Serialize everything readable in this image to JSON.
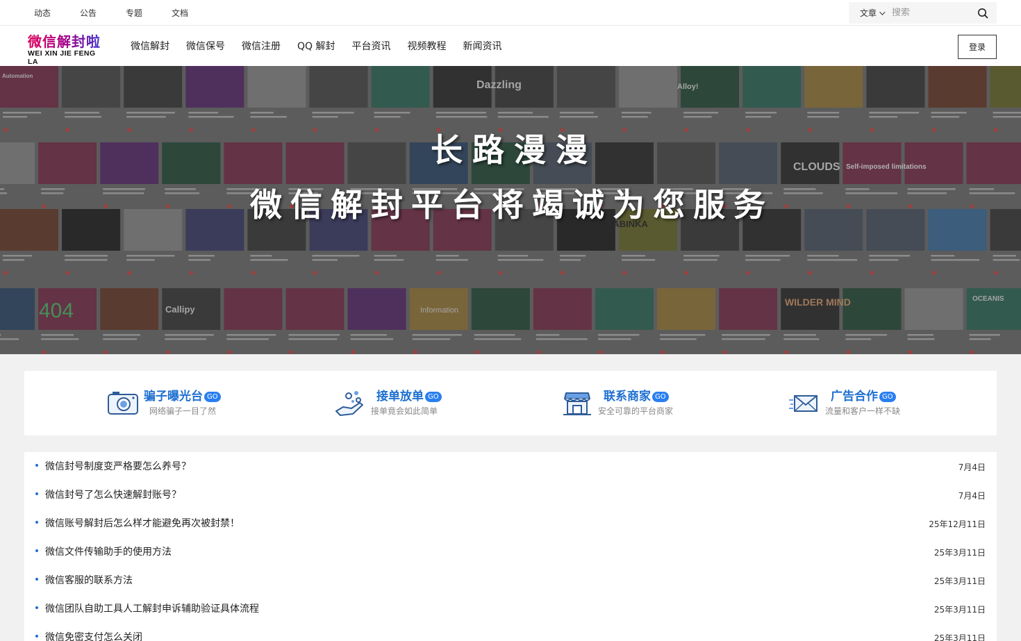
{
  "topbar": {
    "links": [
      "动态",
      "公告",
      "专题",
      "文档"
    ],
    "search": {
      "category": "文章",
      "placeholder": "搜索"
    }
  },
  "header": {
    "logo": {
      "cn": "微信解封啦",
      "en": "WEI XIN JIE FENG LA"
    },
    "nav": [
      "微信解封",
      "微信保号",
      "微信注册",
      "QQ 解封",
      "平台资讯",
      "视频教程",
      "新闻资讯"
    ],
    "login_label": "登录"
  },
  "banner": {
    "title": "长路漫漫",
    "subtitle": "微信解封平台将竭诚为您服务",
    "thumb_texts": [
      "Automation",
      "Dazzling",
      "Alloy!",
      "CLOUDS",
      "Self-imposed limitations",
      "KABINKA",
      "404",
      "Callipy",
      "WILDER MIND",
      "OCEANIS",
      "Information"
    ]
  },
  "features": [
    {
      "icon": "camera-icon",
      "title": "骗子曝光台",
      "badge": "GO",
      "sub": "网络骗子一目了然"
    },
    {
      "icon": "hand-order-icon",
      "title": "接单放单",
      "badge": "GO",
      "sub": "接单竟会如此简单"
    },
    {
      "icon": "shop-icon",
      "title": "联系商家",
      "badge": "GO",
      "sub": "安全可靠的平台商家"
    },
    {
      "icon": "mail-icon",
      "title": "广告合作",
      "badge": "GO",
      "sub": "流量和客户一样不缺"
    }
  ],
  "articles": [
    {
      "title": "微信封号制度变严格要怎么养号？",
      "date": "7月4日"
    },
    {
      "title": "微信封号了怎么快速解封账号？",
      "date": "7月4日"
    },
    {
      "title": "微信账号解封后怎么样才能避免再次被封禁！",
      "date": "25年12月11日"
    },
    {
      "title": "微信文件传输助手的使用方法",
      "date": "25年3月11日"
    },
    {
      "title": "微信客服的联系方法",
      "date": "25年3月11日"
    },
    {
      "title": "微信团队自助工具人工解封申诉辅助验证具体流程",
      "date": "25年3月11日"
    },
    {
      "title": "微信免密支付怎么关闭",
      "date": "25年3月11日"
    }
  ],
  "colors": {
    "accent": "#1d6fd1",
    "badge": "#2a7ff0",
    "page_bg": "#f1f1f1"
  }
}
